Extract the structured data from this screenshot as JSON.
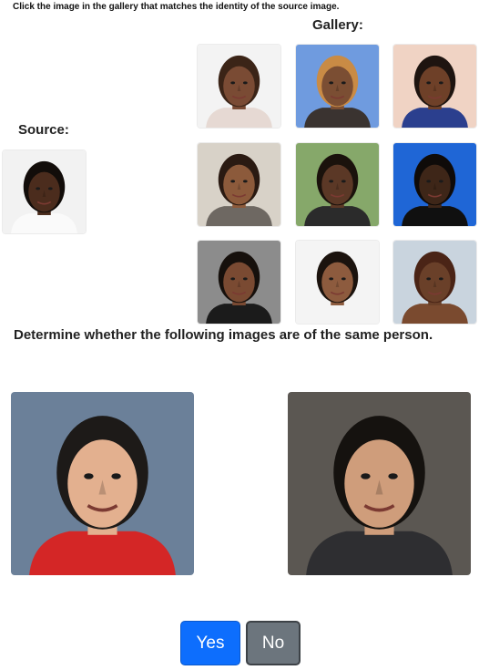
{
  "instruction": "Click the image in the gallery that matches the identity of the source image.",
  "gallery": {
    "label": "Gallery:",
    "images": [
      {
        "bg": "#f3f3f3",
        "skin": "#7a4b34",
        "hair": "#3b2417",
        "top": "#e6d9d3"
      },
      {
        "bg": "#6f9bdf",
        "skin": "#7b4e33",
        "hair": "#c98b45",
        "top": "#3a3330"
      },
      {
        "bg": "#f0d3c4",
        "skin": "#6e4028",
        "hair": "#1e1410",
        "top": "#2b3f8e"
      },
      {
        "bg": "#d8d2c8",
        "skin": "#8c5a3b",
        "hair": "#2a1a12",
        "top": "#6e6862"
      },
      {
        "bg": "#86a86a",
        "skin": "#5b3826",
        "hair": "#1a120c",
        "top": "#2b2b2b"
      },
      {
        "bg": "#1f66d6",
        "skin": "#3e2618",
        "hair": "#0f0b09",
        "top": "#101010"
      },
      {
        "bg": "#8c8c8c",
        "skin": "#7a4a32",
        "hair": "#16100c",
        "top": "#1b1b1b"
      },
      {
        "bg": "#f4f4f4",
        "skin": "#8d5b3e",
        "hair": "#1b130e",
        "top": "#f4f4f4"
      },
      {
        "bg": "#c9d4de",
        "skin": "#6a4029",
        "hair": "#4a2416",
        "top": "#7a4a2f"
      }
    ]
  },
  "source": {
    "label": "Source:",
    "image": {
      "bg": "#f2f2f2",
      "skin": "#4b2c1d",
      "hair": "#120d0a",
      "top": "#fafafa"
    }
  },
  "question": "Determine whether the following images are of the same person.",
  "pair": {
    "left": {
      "bg": "#6b8099",
      "skin": "#e3b08f",
      "hair": "#1d1a18",
      "top": "#d42626"
    },
    "right": {
      "bg": "#5b5752",
      "skin": "#cf9d7b",
      "hair": "#15120f",
      "top": "#2e2e31"
    }
  },
  "buttons": {
    "yes": "Yes",
    "no": "No"
  }
}
